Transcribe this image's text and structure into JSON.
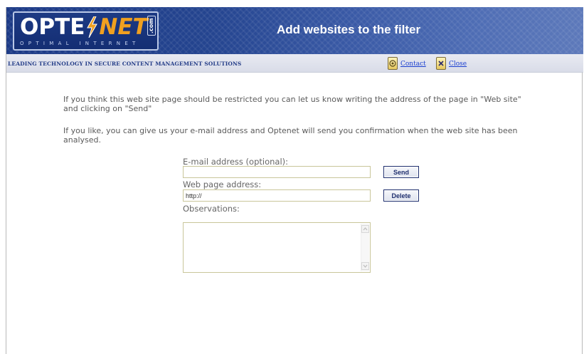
{
  "header": {
    "logo_left": "OPTE",
    "logo_right": "NET",
    "logo_suffix": ".com",
    "logo_tagline": "OPTIMAL INTERNET",
    "title": "Add websites to the filter"
  },
  "subbar": {
    "slogan": "LEADING TECHNOLOGY IN SECURE CONTENT MANAGEMENT SOLUTIONS",
    "contact_label": "Contact",
    "close_label": "Close"
  },
  "content": {
    "intro_1": "If you think this web site page should be restricted you can let us know writing the address of the page in \"Web site\" and clicking on \"Send\"",
    "intro_2": "If you like, you can give us your e-mail address and Optenet will send you confirmation when the web site has been analysed."
  },
  "form": {
    "email_label": "E-mail address (optional):",
    "email_value": "",
    "send_label": "Send",
    "url_label": "Web page address:",
    "url_value": "http://",
    "delete_label": "Delete",
    "observations_label": "Observations:",
    "observations_value": ""
  },
  "colors": {
    "brand_blue": "#1c3a86",
    "brand_orange": "#f0a020",
    "link_blue": "#1a3fd0"
  },
  "icons": {
    "contact": "contact-icon",
    "close": "close-icon",
    "bolt": "lightning-bolt-icon"
  }
}
